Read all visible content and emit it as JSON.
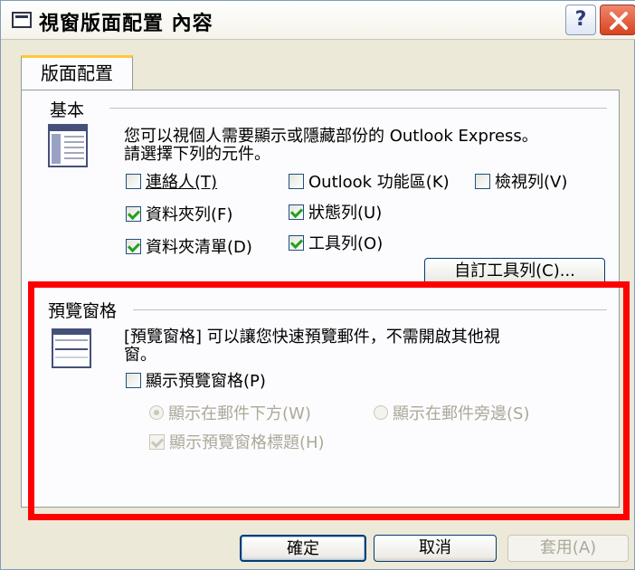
{
  "window": {
    "title": "視窗版面配置 內容"
  },
  "tabs": [
    {
      "label": "版面配置"
    }
  ],
  "basic": {
    "label": "基本",
    "description_line1": "您可以視個人需要顯示或隱藏部份的 Outlook Express。",
    "description_line2": "請選擇下列的元件。",
    "options": [
      {
        "label": "連絡人(T)",
        "checked": false
      },
      {
        "label": "Outlook 功能區(K)",
        "checked": false
      },
      {
        "label": "檢視列(V)",
        "checked": false
      },
      {
        "label": "資料夾列(F)",
        "checked": true
      },
      {
        "label": "狀態列(U)",
        "checked": true
      },
      {
        "label": "資料夾清單(D)",
        "checked": true
      },
      {
        "label": "工具列(O)",
        "checked": true
      }
    ],
    "customize_button": "自訂工具列(C)..."
  },
  "preview": {
    "label": "預覽窗格",
    "description_line1": "[預覽窗格] 可以讓您快速預覽郵件，不需開啟其他視",
    "description_line2": "窗。",
    "show_preview": {
      "label": "顯示預覽窗格(P)",
      "checked": false
    },
    "below_radio": {
      "label": "顯示在郵件下方(W)",
      "selected": true,
      "enabled": false
    },
    "beside_radio": {
      "label": "顯示在郵件旁邊(S)",
      "selected": false,
      "enabled": false
    },
    "show_header": {
      "label": "顯示預覽窗格標題(H)",
      "checked": true,
      "enabled": false
    }
  },
  "buttons": {
    "ok": "確定",
    "cancel": "取消",
    "apply": "套用(A)"
  },
  "colors": {
    "highlight": "#ff0000",
    "dialog_bg": "#ece9d8",
    "tab_accent": "#ffc83c"
  }
}
